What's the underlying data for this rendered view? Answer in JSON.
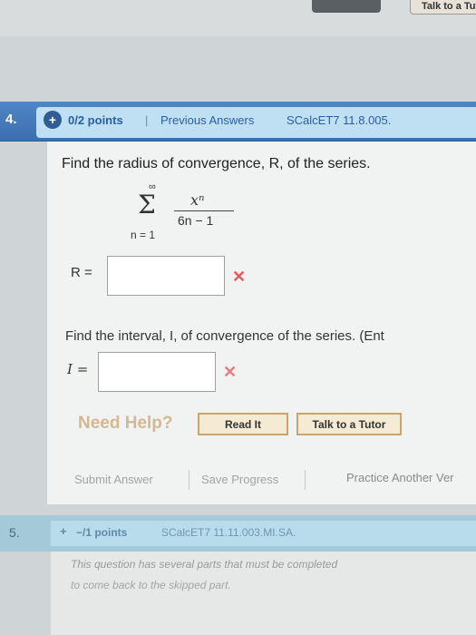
{
  "top": {
    "tutor_button_label": "Talk to a Tutor"
  },
  "question4": {
    "number": "4.",
    "points": "0/2 points",
    "separator": "|",
    "previous_answers": "Previous Answers",
    "course_code": "SCalcET7 11.8.005.",
    "prompt_radius": "Find the radius of convergence, R, of the series.",
    "series": {
      "upper": "∞",
      "sigma": "Σ",
      "lower": "n = 1",
      "numerator": "xⁿ",
      "denominator": "6n − 1"
    },
    "r_label": "R =",
    "r_value": "",
    "r_status": "✕",
    "prompt_interval": "Find the interval, I, of convergence of the series. (Ent",
    "i_label": "I =",
    "i_value": "",
    "i_status": "✕",
    "need_help": "Need Help?",
    "read_it": "Read It",
    "talk_to_tutor": "Talk to a Tutor",
    "submit_answer": "Submit Answer",
    "save_progress": "Save Progress",
    "practice_another": "Practice Another Ver"
  },
  "question5": {
    "number": "5.",
    "plus": "+",
    "points": "−/1 points",
    "course_code": "SCalcET7 11.11.003.MI.SA.",
    "note_line1": "This question has several parts that must be completed",
    "note_line2": "to come back to the skipped part."
  },
  "colors": {
    "header_blue": "#3c6fb0",
    "link_blue": "#2a5ea0",
    "error_red": "#e35a5a",
    "help_button_border": "#c9a56b"
  }
}
